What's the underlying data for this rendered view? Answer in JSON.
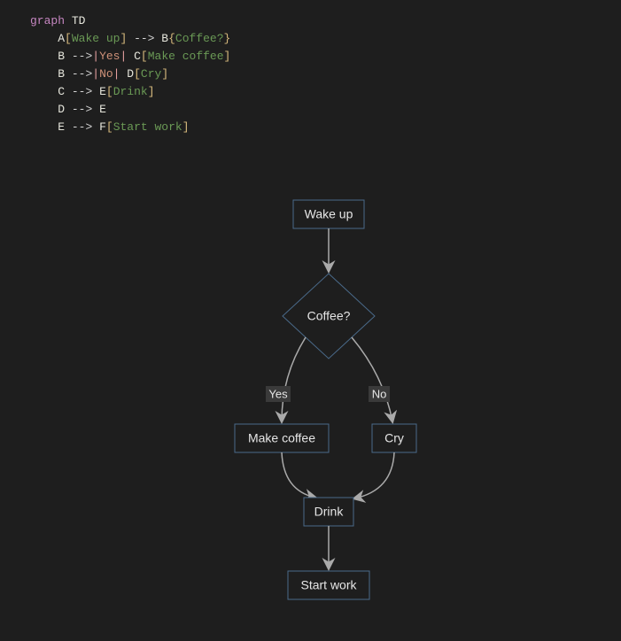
{
  "code": {
    "graph_kw": "graph",
    "td_kw": "TD",
    "lines": [
      {
        "lhs_id": "A",
        "lhs_open": "[",
        "lhs_text": "Wake up",
        "lhs_close": "]",
        "arrow": "-->",
        "rhs_id": "B",
        "rhs_open": "{",
        "rhs_text": "Coffee?",
        "rhs_close": "}"
      },
      {
        "lhs_id": "B",
        "arrow": "-->",
        "pipe_open": "|",
        "pipe_text": "Yes",
        "pipe_close": "|",
        "rhs_id": "C",
        "rhs_open": "[",
        "rhs_text": "Make coffee",
        "rhs_close": "]"
      },
      {
        "lhs_id": "B",
        "arrow": "-->",
        "pipe_open": "|",
        "pipe_text": "No",
        "pipe_close": "|",
        "rhs_id": "D",
        "rhs_open": "[",
        "rhs_text": "Cry",
        "rhs_close": "]"
      },
      {
        "lhs_id": "C",
        "arrow": "-->",
        "rhs_id": "E",
        "rhs_open": "[",
        "rhs_text": "Drink",
        "rhs_close": "]"
      },
      {
        "lhs_id": "D",
        "arrow": "-->",
        "rhs_id": "E"
      },
      {
        "lhs_id": "E",
        "arrow": "-->",
        "rhs_id": "F",
        "rhs_open": "[",
        "rhs_text": "Start work",
        "rhs_close": "]"
      }
    ]
  },
  "diagram": {
    "nodes": {
      "A": {
        "label": "Wake up",
        "shape": "rect"
      },
      "B": {
        "label": "Coffee?",
        "shape": "diamond"
      },
      "C": {
        "label": "Make coffee",
        "shape": "rect"
      },
      "D": {
        "label": "Cry",
        "shape": "rect"
      },
      "E": {
        "label": "Drink",
        "shape": "rect"
      },
      "F": {
        "label": "Start work",
        "shape": "rect"
      }
    },
    "edges": {
      "A_B": {
        "label": ""
      },
      "B_C": {
        "label": "Yes"
      },
      "B_D": {
        "label": "No"
      },
      "C_E": {
        "label": ""
      },
      "D_E": {
        "label": ""
      },
      "E_F": {
        "label": ""
      }
    }
  }
}
